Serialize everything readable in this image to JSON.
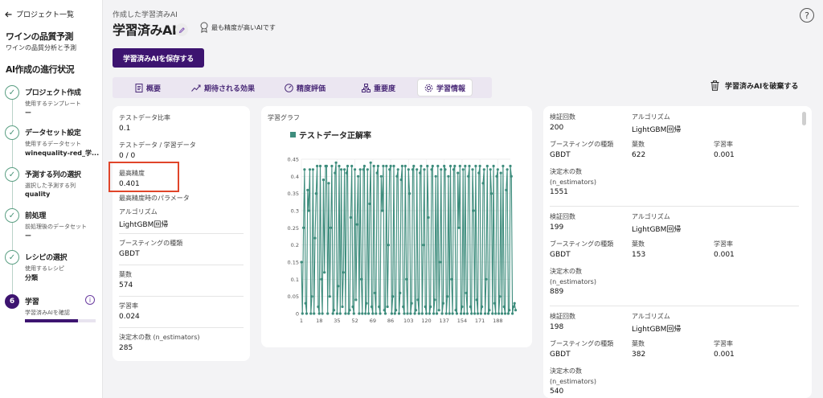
{
  "sidebar": {
    "back_label": "プロジェクト一覧",
    "project_title": "ワインの品質予測",
    "project_subtitle": "ワインの品質分析と予測",
    "steps_heading": "AI作成の進行状況",
    "steps": [
      {
        "title": "プロジェクト作成",
        "small": "使用するテンプレート",
        "value": "ー"
      },
      {
        "title": "データセット設定",
        "small": "使用するデータセット",
        "value": "winequality-red_学..."
      },
      {
        "title": "予測する列の選択",
        "small": "選択した予測する列",
        "value": "quality"
      },
      {
        "title": "前処理",
        "small": "前処理後のデータセット",
        "value": "ー"
      },
      {
        "title": "レシピの選択",
        "small": "使用するレシピ",
        "value": "分類"
      },
      {
        "title": "学習",
        "small": "学習済みAIを確認",
        "number": "6",
        "progress": 0.75
      }
    ]
  },
  "header": {
    "label": "作成した学習済みAI",
    "title": "学習済みAI",
    "best_text": "最も精度が高いAIです",
    "help": "?",
    "save_button": "学習済みAIを保存する",
    "discard_button": "学習済みAIを破棄する"
  },
  "tabs": [
    {
      "label": "概要",
      "icon": "document-icon"
    },
    {
      "label": "期待される効果",
      "icon": "trend-icon"
    },
    {
      "label": "精度評価",
      "icon": "gauge-icon"
    },
    {
      "label": "重要度",
      "icon": "hierarchy-icon"
    },
    {
      "label": "学習情報",
      "icon": "gear-icon",
      "active": true
    }
  ],
  "summary": {
    "test_ratio_label": "テストデータ比率",
    "test_ratio": "0.1",
    "test_train_label": "テストデータ / 学習データ",
    "test_train": "0 / 0",
    "best_acc_label": "最高精度",
    "best_acc": "0.401",
    "params_heading": "最高精度時のパラメータ",
    "algo_label": "アルゴリズム",
    "algo": "LightGBM回帰",
    "boost_label": "ブースティングの種類",
    "boost": "GBDT",
    "leaves_label": "葉数",
    "leaves": "574",
    "lr_label": "学習率",
    "lr": "0.024",
    "trees_label": "決定木の数 (n_estimators)",
    "trees": "285"
  },
  "graph": {
    "label": "学習グラフ"
  },
  "chart_data": {
    "type": "line",
    "series": [
      {
        "name": "テストデータ正解率",
        "values": [
          0.15,
          0.0,
          0.25,
          0.42,
          0.03,
          0.0,
          0.36,
          0.3,
          0.42,
          0.0,
          0.05,
          0.42,
          0.0,
          0.22,
          0.35,
          0.43,
          0.02,
          0.0,
          0.43,
          0.1,
          0.0,
          0.39,
          0.12,
          0.43,
          0.43,
          0.0,
          0.38,
          0.05,
          0.25,
          0.43,
          0.0,
          0.01,
          0.41,
          0.44,
          0.0,
          0.08,
          0.43,
          0.0,
          0.42,
          0.02,
          0.12,
          0.42,
          0.0,
          0.41,
          0.43,
          0.0,
          0.01,
          0.28,
          0.43,
          0.02,
          0.0,
          0.42,
          0.04,
          0.26,
          0.4,
          0.0,
          0.42,
          0.1,
          0.0,
          0.42,
          0.43,
          0.0,
          0.03,
          0.42,
          0.0,
          0.32,
          0.44,
          0.02,
          0.0,
          0.43,
          0.06,
          0.0,
          0.41,
          0.43,
          0.02,
          0.0,
          0.4,
          0.3,
          0.43,
          0.01,
          0.0,
          0.43,
          0.02,
          0.2,
          0.42,
          0.43,
          0.0,
          0.05,
          0.43,
          0.0,
          0.01,
          0.4,
          0.42,
          0.0,
          0.06,
          0.39,
          0.43,
          0.02,
          0.0,
          0.43,
          0.1,
          0.0,
          0.42,
          0.35,
          0.0,
          0.03,
          0.42,
          0.43,
          0.0,
          0.01,
          0.42,
          0.04,
          0.0,
          0.41,
          0.43,
          0.0,
          0.2,
          0.42,
          0.02,
          0.0,
          0.43,
          0.28,
          0.0,
          0.02,
          0.42,
          0.43,
          0.0,
          0.04,
          0.4,
          0.0,
          0.43,
          0.01,
          0.15,
          0.42,
          0.0,
          0.03,
          0.43,
          0.42,
          0.0,
          0.05,
          0.4,
          0.0,
          0.43,
          0.1,
          0.0,
          0.42,
          0.43,
          0.01,
          0.0,
          0.41,
          0.25,
          0.43,
          0.0,
          0.02,
          0.42,
          0.0,
          0.43,
          0.06,
          0.0,
          0.4,
          0.43,
          0.02,
          0.0,
          0.42,
          0.3,
          0.0,
          0.43,
          0.04,
          0.0,
          0.41,
          0.43,
          0.0,
          0.02,
          0.38,
          0.42,
          0.0,
          0.1,
          0.43,
          0.0,
          0.01,
          0.42,
          0.35,
          0.0,
          0.43,
          0.03,
          0.0,
          0.4,
          0.42,
          0.0,
          0.05,
          0.41,
          0.0,
          0.43,
          0.02,
          0.0,
          0.36,
          0.42,
          0.0,
          0.01,
          0.43,
          0.4,
          0.0,
          0.02,
          0.03,
          0.01
        ]
      }
    ],
    "x_ticks": [
      "1",
      "18",
      "35",
      "52",
      "69",
      "86",
      "103",
      "120",
      "137",
      "154",
      "171",
      "188"
    ],
    "y_ticks": [
      "0",
      "0.05",
      "0.1",
      "0.15",
      "0.2",
      "0.25",
      "0.3",
      "0.35",
      "0.4",
      "0.45"
    ],
    "ylim": [
      0,
      0.45
    ],
    "x_count": 200,
    "color": "#3e8d7d",
    "grid": true
  },
  "history": [
    {
      "count_label": "検証回数",
      "count": "200",
      "algo_label": "アルゴリズム",
      "algo": "LightGBM回帰",
      "boost_label": "ブースティングの種類",
      "boost": "GBDT",
      "leaves_label": "葉数",
      "leaves": "622",
      "lr_label": "学習率",
      "lr": "0.001",
      "trees_label": "決定木の数",
      "trees_sub": "(n_estimators)",
      "trees": "1551"
    },
    {
      "count_label": "検証回数",
      "count": "199",
      "algo_label": "アルゴリズム",
      "algo": "LightGBM回帰",
      "boost_label": "ブースティングの種類",
      "boost": "GBDT",
      "leaves_label": "葉数",
      "leaves": "153",
      "lr_label": "学習率",
      "lr": "0.001",
      "trees_label": "決定木の数",
      "trees_sub": "(n_estimators)",
      "trees": "889"
    },
    {
      "count_label": "検証回数",
      "count": "198",
      "algo_label": "アルゴリズム",
      "algo": "LightGBM回帰",
      "boost_label": "ブースティングの種類",
      "boost": "GBDT",
      "leaves_label": "葉数",
      "leaves": "382",
      "lr_label": "学習率",
      "lr": "0.001",
      "trees_label": "決定木の数",
      "trees_sub": "(n_estimators)",
      "trees": "540"
    }
  ]
}
